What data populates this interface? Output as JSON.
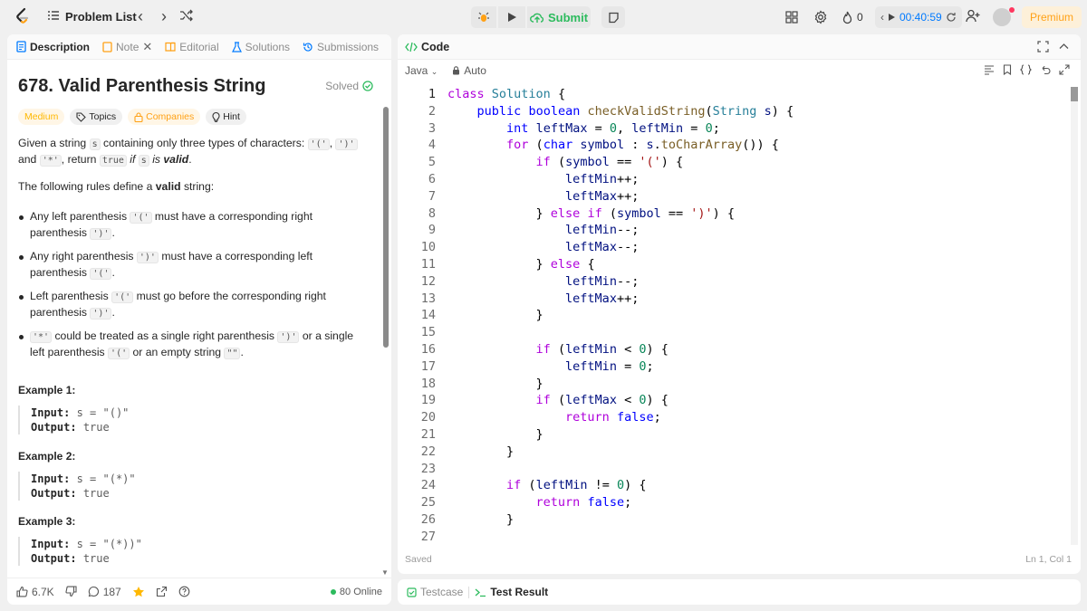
{
  "topbar": {
    "problem_list": "Problem List",
    "submit": "Submit",
    "streak": "0",
    "timer": "00:40:59",
    "premium": "Premium"
  },
  "tabs": [
    {
      "label": "Description"
    },
    {
      "label": "Note"
    },
    {
      "label": "Editorial"
    },
    {
      "label": "Solutions"
    },
    {
      "label": "Submissions"
    }
  ],
  "problem": {
    "title": "678. Valid Parenthesis String",
    "status": "Solved",
    "chips": {
      "difficulty": "Medium",
      "topics": "Topics",
      "companies": "Companies",
      "hint": "Hint"
    },
    "intro_1": "Given a string",
    "intro_s": "s",
    "intro_2": "containing only three types of characters:",
    "c_open": "'('",
    "c_close": "')'",
    "and": "and",
    "c_star": "'*'",
    "intro_3": "return",
    "true": "true",
    "intro_4": "if",
    "intro_5": "is",
    "valid": "valid",
    "rules_intro_1": "The following rules define a",
    "rules_intro_2": "string:",
    "rule1_a": "Any left parenthesis",
    "rule1_b": "must have a corresponding right parenthesis",
    "rule2_a": "Any right parenthesis",
    "rule2_b": "must have a corresponding left parenthesis",
    "rule3_a": "Left parenthesis",
    "rule3_b": "must go before the corresponding right parenthesis",
    "rule4_a": "could be treated as a single right parenthesis",
    "rule4_b": "or a single left parenthesis",
    "rule4_c": "or an empty string",
    "empty_str": "\"\"",
    "examples": [
      {
        "heading": "Example 1:",
        "input_label": "Input:",
        "input": "s = \"()\"",
        "output_label": "Output:",
        "output": "true"
      },
      {
        "heading": "Example 2:",
        "input_label": "Input:",
        "input": "s = \"(*)\"",
        "output_label": "Output:",
        "output": "true"
      },
      {
        "heading": "Example 3:",
        "input_label": "Input:",
        "input": "s = \"(*))\"",
        "output_label": "Output:",
        "output": "true"
      }
    ]
  },
  "footer": {
    "likes": "6.7K",
    "comments": "187",
    "online": "80 Online"
  },
  "code": {
    "title": "Code",
    "language": "Java",
    "mode": "Auto",
    "status": "Saved",
    "cursor": "Ln 1, Col 1",
    "line_numbers": [
      "1",
      "2",
      "3",
      "4",
      "5",
      "6",
      "7",
      "8",
      "9",
      "10",
      "11",
      "12",
      "13",
      "14",
      "15",
      "16",
      "17",
      "18",
      "19",
      "20",
      "21",
      "22",
      "23",
      "24",
      "25",
      "26",
      "27"
    ]
  },
  "bottom": {
    "testcase": "Testcase",
    "result": "Test Result"
  },
  "colors": {
    "accent": "#ffa116",
    "submit": "#2cbb5d",
    "timer": "#007aff"
  }
}
